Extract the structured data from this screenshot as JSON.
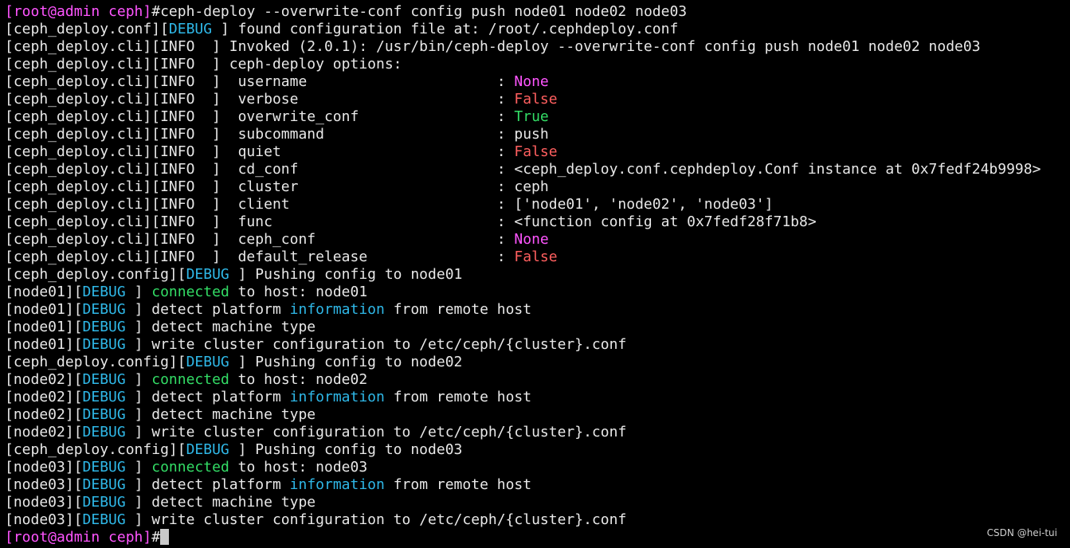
{
  "colors": {
    "background": "#000000",
    "default": "#e8e8e8",
    "magenta": "#ff55ff",
    "red": "#ff5f5f",
    "green": "#33dd66",
    "cyan": "#2fb8e8"
  },
  "watermark": "CSDN @hei-tui",
  "lines": [
    [
      {
        "text": "[root@admin ceph]",
        "color": "magenta"
      },
      {
        "text": "#ceph-deploy --overwrite-conf config push node01 node02 node03"
      }
    ],
    [
      {
        "text": "[ceph_deploy.conf]["
      },
      {
        "text": "DEBUG",
        "color": "cyan"
      },
      {
        "text": " ] found configuration file at: /root/.cephdeploy.conf"
      }
    ],
    [
      {
        "text": "[ceph_deploy.cli][INFO  ] Invoked (2.0.1): /usr/bin/ceph-deploy --overwrite-conf config push node01 node02 node03"
      }
    ],
    [
      {
        "text": "[ceph_deploy.cli][INFO  ] ceph-deploy options:"
      }
    ],
    [
      {
        "text": "[ceph_deploy.cli][INFO  ]  username                      : "
      },
      {
        "text": "None",
        "color": "magenta"
      }
    ],
    [
      {
        "text": "[ceph_deploy.cli][INFO  ]  verbose                       : "
      },
      {
        "text": "False",
        "color": "red"
      }
    ],
    [
      {
        "text": "[ceph_deploy.cli][INFO  ]  overwrite_conf                : "
      },
      {
        "text": "True",
        "color": "green"
      }
    ],
    [
      {
        "text": "[ceph_deploy.cli][INFO  ]  subcommand                    : push"
      }
    ],
    [
      {
        "text": "[ceph_deploy.cli][INFO  ]  quiet                         : "
      },
      {
        "text": "False",
        "color": "red"
      }
    ],
    [
      {
        "text": "[ceph_deploy.cli][INFO  ]  cd_conf                       : <ceph_deploy.conf.cephdeploy.Conf instance at 0x7fedf24b9998>"
      }
    ],
    [
      {
        "text": "[ceph_deploy.cli][INFO  ]  cluster                       : ceph"
      }
    ],
    [
      {
        "text": "[ceph_deploy.cli][INFO  ]  client                        : ['node01', 'node02', 'node03']"
      }
    ],
    [
      {
        "text": "[ceph_deploy.cli][INFO  ]  func                          : <function config at 0x7fedf28f71b8>"
      }
    ],
    [
      {
        "text": "[ceph_deploy.cli][INFO  ]  ceph_conf                     : "
      },
      {
        "text": "None",
        "color": "magenta"
      }
    ],
    [
      {
        "text": "[ceph_deploy.cli][INFO  ]  default_release               : "
      },
      {
        "text": "False",
        "color": "red"
      }
    ],
    [
      {
        "text": "[ceph_deploy.config]["
      },
      {
        "text": "DEBUG",
        "color": "cyan"
      },
      {
        "text": " ] Pushing config to node01"
      }
    ],
    [
      {
        "text": "[node01]["
      },
      {
        "text": "DEBUG",
        "color": "cyan"
      },
      {
        "text": " ] "
      },
      {
        "text": "connected",
        "color": "green"
      },
      {
        "text": " to host: node01"
      }
    ],
    [
      {
        "text": "[node01]["
      },
      {
        "text": "DEBUG",
        "color": "cyan"
      },
      {
        "text": " ] detect platform "
      },
      {
        "text": "information",
        "color": "cyan"
      },
      {
        "text": " from remote host"
      }
    ],
    [
      {
        "text": "[node01]["
      },
      {
        "text": "DEBUG",
        "color": "cyan"
      },
      {
        "text": " ] detect machine type"
      }
    ],
    [
      {
        "text": "[node01]["
      },
      {
        "text": "DEBUG",
        "color": "cyan"
      },
      {
        "text": " ] write cluster configuration to /etc/ceph/{cluster}.conf"
      }
    ],
    [
      {
        "text": "[ceph_deploy.config]["
      },
      {
        "text": "DEBUG",
        "color": "cyan"
      },
      {
        "text": " ] Pushing config to node02"
      }
    ],
    [
      {
        "text": "[node02]["
      },
      {
        "text": "DEBUG",
        "color": "cyan"
      },
      {
        "text": " ] "
      },
      {
        "text": "connected",
        "color": "green"
      },
      {
        "text": " to host: node02"
      }
    ],
    [
      {
        "text": "[node02]["
      },
      {
        "text": "DEBUG",
        "color": "cyan"
      },
      {
        "text": " ] detect platform "
      },
      {
        "text": "information",
        "color": "cyan"
      },
      {
        "text": " from remote host"
      }
    ],
    [
      {
        "text": "[node02]["
      },
      {
        "text": "DEBUG",
        "color": "cyan"
      },
      {
        "text": " ] detect machine type"
      }
    ],
    [
      {
        "text": "[node02]["
      },
      {
        "text": "DEBUG",
        "color": "cyan"
      },
      {
        "text": " ] write cluster configuration to /etc/ceph/{cluster}.conf"
      }
    ],
    [
      {
        "text": "[ceph_deploy.config]["
      },
      {
        "text": "DEBUG",
        "color": "cyan"
      },
      {
        "text": " ] Pushing config to node03"
      }
    ],
    [
      {
        "text": "[node03]["
      },
      {
        "text": "DEBUG",
        "color": "cyan"
      },
      {
        "text": " ] "
      },
      {
        "text": "connected",
        "color": "green"
      },
      {
        "text": " to host: node03"
      }
    ],
    [
      {
        "text": "[node03]["
      },
      {
        "text": "DEBUG",
        "color": "cyan"
      },
      {
        "text": " ] detect platform "
      },
      {
        "text": "information",
        "color": "cyan"
      },
      {
        "text": " from remote host"
      }
    ],
    [
      {
        "text": "[node03]["
      },
      {
        "text": "DEBUG",
        "color": "cyan"
      },
      {
        "text": " ] detect machine type"
      }
    ],
    [
      {
        "text": "[node03]["
      },
      {
        "text": "DEBUG",
        "color": "cyan"
      },
      {
        "text": " ] write cluster configuration to /etc/ceph/{cluster}.conf"
      }
    ],
    [
      {
        "text": "[root@admin ceph]",
        "color": "magenta"
      },
      {
        "text": "#"
      }
    ]
  ]
}
